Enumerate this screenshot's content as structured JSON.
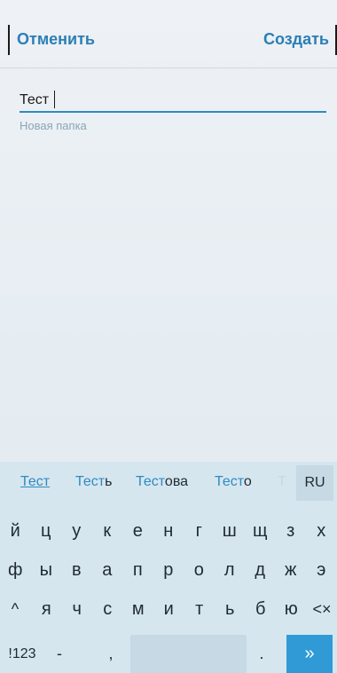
{
  "header": {
    "cancel_label": "Отменить",
    "create_label": "Создать"
  },
  "form": {
    "name_value": "Тест",
    "hint": "Новая папка"
  },
  "keyboard": {
    "suggestions": [
      {
        "bold": "Тест",
        "rest": ""
      },
      {
        "bold": "Тест",
        "rest": "ь"
      },
      {
        "bold": "Тест",
        "rest": "ова"
      },
      {
        "bold": "Тест",
        "rest": "о"
      },
      {
        "bold": "Т",
        "rest": ""
      }
    ],
    "lang_label": "RU",
    "row1": [
      "й",
      "ц",
      "у",
      "к",
      "е",
      "н",
      "г",
      "ш",
      "щ",
      "з",
      "х"
    ],
    "row2": [
      "ф",
      "ы",
      "в",
      "а",
      "п",
      "р",
      "о",
      "л",
      "д",
      "ж",
      "э"
    ],
    "row3": [
      "я",
      "ч",
      "с",
      "м",
      "и",
      "т",
      "ь",
      "б",
      "ю"
    ],
    "shift_icon": "^",
    "backspace_icon": "<×",
    "num_label": "!123",
    "minus": "-",
    "comma": ",",
    "period": ".",
    "go_icon": "»"
  },
  "colors": {
    "accent": "#2a7fb5",
    "keyboard_bg": "#d6e6ef",
    "go_button": "#2f9ad6"
  }
}
